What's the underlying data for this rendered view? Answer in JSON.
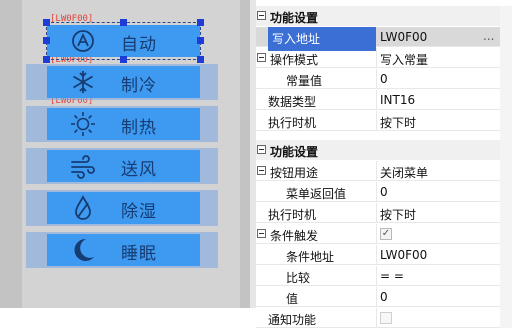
{
  "canvas": {
    "address_tag": "[LW0F00]",
    "buttons": [
      {
        "label": "自动",
        "icon": "auto-mode-icon"
      },
      {
        "label": "制冷",
        "icon": "snowflake-icon"
      },
      {
        "label": "制热",
        "icon": "sun-icon"
      },
      {
        "label": "送风",
        "icon": "wind-icon"
      },
      {
        "label": "除湿",
        "icon": "droplet-icon"
      },
      {
        "label": "睡眠",
        "icon": "moon-icon"
      }
    ]
  },
  "props": {
    "group1": {
      "title": "功能设置",
      "write_addr_label": "写入地址",
      "write_addr_value": "LW0F00",
      "write_addr_more": "...",
      "op_mode_label": "操作模式",
      "op_mode_value": "写入常量",
      "const_label": "常量值",
      "const_value": "0",
      "dtype_label": "数据类型",
      "dtype_value": "INT16",
      "exec_label": "执行时机",
      "exec_value": "按下时"
    },
    "group2": {
      "title": "功能设置",
      "use_label": "按钮用途",
      "use_value": "关闭菜单",
      "menu_ret_label": "菜单返回值",
      "menu_ret_value": "0",
      "exec_label": "执行时机",
      "exec_value": "按下时",
      "cond_label": "条件触发",
      "cond_checked": true,
      "cond_addr_label": "条件地址",
      "cond_addr_value": "LW0F00",
      "cmp_label": "比较",
      "cmp_value": "= =",
      "val_label": "值",
      "val_value": "0",
      "notify_label": "通知功能",
      "notify_checked": false
    }
  }
}
